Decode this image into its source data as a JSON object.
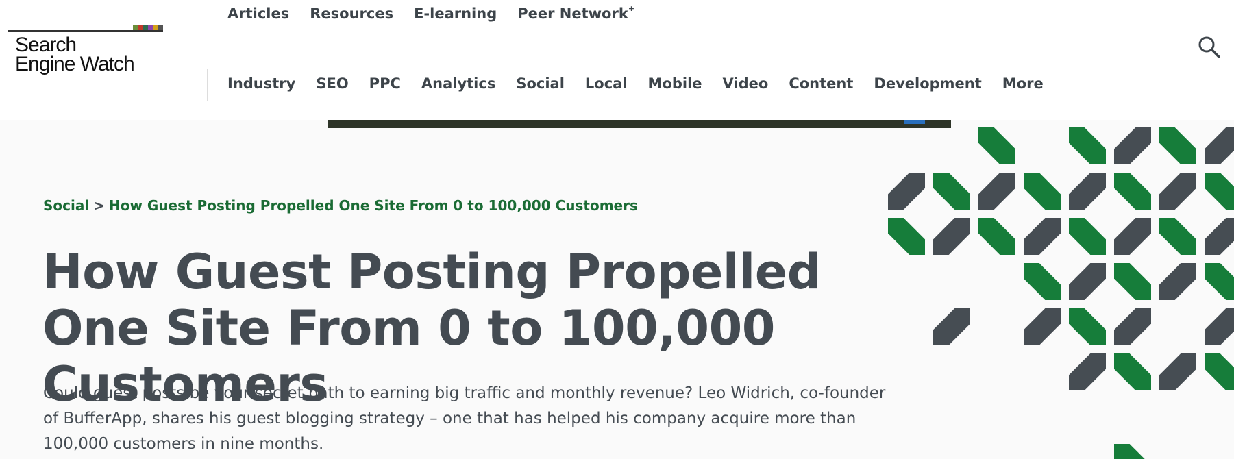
{
  "logo": {
    "line1": "Search",
    "line2": "Engine Watch",
    "bar_colors": [
      "#6b8e3a",
      "#c0392b",
      "#2d6a4f",
      "#8e44ad",
      "#d4a017",
      "#555555"
    ]
  },
  "top_nav": [
    {
      "label": "Articles"
    },
    {
      "label": "Resources"
    },
    {
      "label": "E-learning"
    },
    {
      "label": "Peer Network",
      "sup": "+"
    }
  ],
  "main_nav": [
    {
      "label": "Industry"
    },
    {
      "label": "SEO"
    },
    {
      "label": "PPC"
    },
    {
      "label": "Analytics"
    },
    {
      "label": "Social"
    },
    {
      "label": "Local"
    },
    {
      "label": "Mobile"
    },
    {
      "label": "Video"
    },
    {
      "label": "Content"
    },
    {
      "label": "Development"
    },
    {
      "label": "More"
    }
  ],
  "icons": {
    "search": "search-icon"
  },
  "breadcrumb": {
    "category": "Social",
    "separator": ">",
    "current": "How Guest Posting Propelled One Site From 0 to 100,000 Customers"
  },
  "article": {
    "title": "How Guest Posting Propelled One Site From 0 to 100,000 Customers",
    "summary": "Could guest posts be your secret path to earning big traffic and monthly revenue? Leo Widrich, co-founder of BufferApp, shares his guest blogging strategy – one that has helped his company acquire more than 100,000 customers in nine months."
  },
  "colors": {
    "accent_green": "#1a6b34",
    "text_gray": "#444b52",
    "pattern_green": "#167d3a",
    "pattern_gray": "#464d53"
  }
}
